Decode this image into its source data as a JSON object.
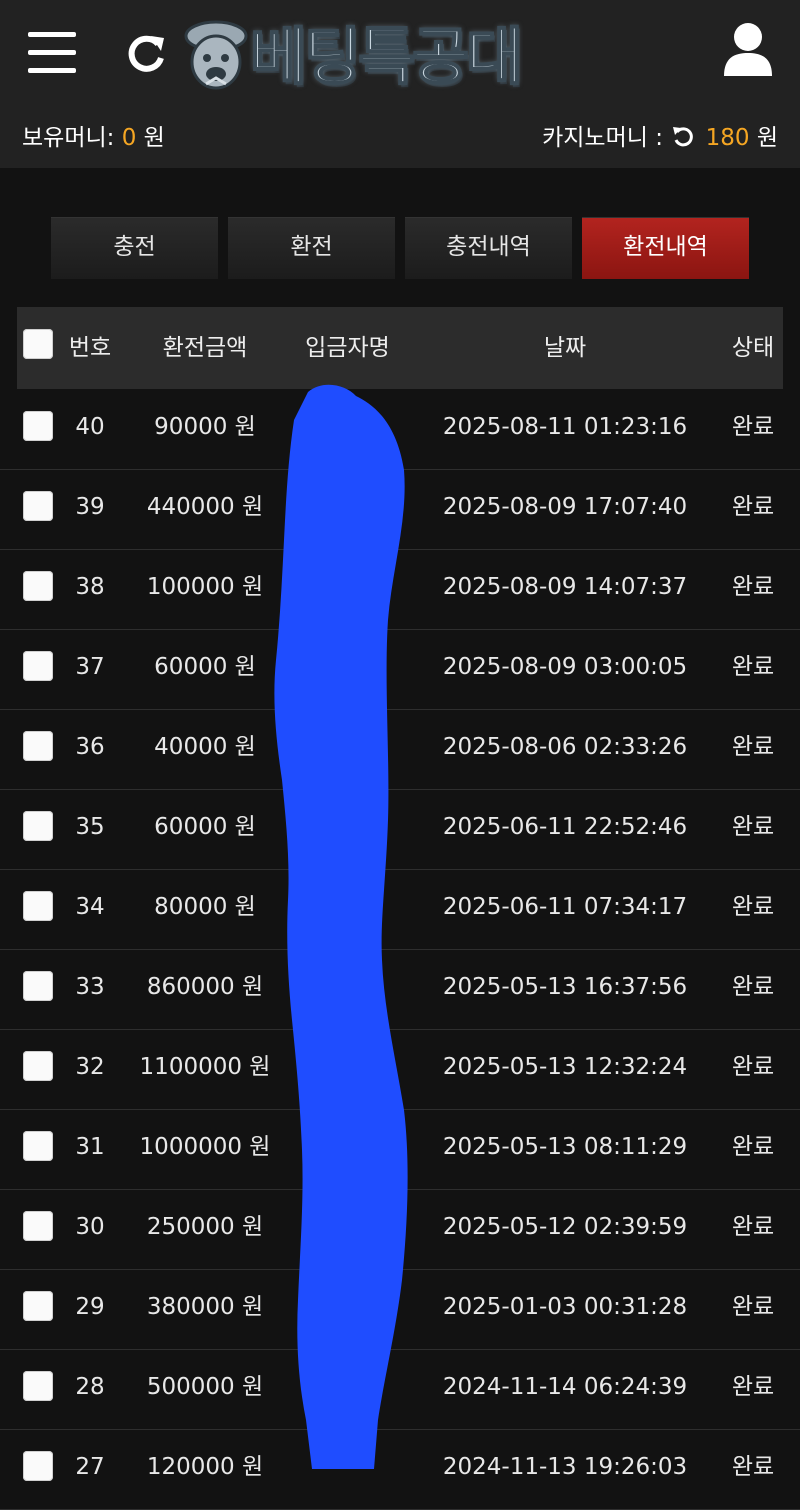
{
  "header": {
    "logo_text": "베팅특공대",
    "balance_label": "보유머니:",
    "balance_value": "0",
    "currency": "원",
    "casino_label": "카지노머니 :",
    "casino_value": "180",
    "casino_currency": "원"
  },
  "tabs": [
    {
      "label": "충전",
      "active": false
    },
    {
      "label": "환전",
      "active": false
    },
    {
      "label": "충전내역",
      "active": false
    },
    {
      "label": "환전내역",
      "active": true
    }
  ],
  "table": {
    "columns": [
      "번호",
      "환전금액",
      "입금자명",
      "날짜",
      "상태"
    ],
    "rows": [
      {
        "no": "40",
        "amount": "90000 원",
        "depositor": "",
        "date": "2025-08-11 01:23:16",
        "status": "완료"
      },
      {
        "no": "39",
        "amount": "440000 원",
        "depositor": "",
        "date": "2025-08-09 17:07:40",
        "status": "완료"
      },
      {
        "no": "38",
        "amount": "100000 원",
        "depositor": "",
        "date": "2025-08-09 14:07:37",
        "status": "완료"
      },
      {
        "no": "37",
        "amount": "60000 원",
        "depositor": "",
        "date": "2025-08-09 03:00:05",
        "status": "완료"
      },
      {
        "no": "36",
        "amount": "40000 원",
        "depositor": "",
        "date": "2025-08-06 02:33:26",
        "status": "완료"
      },
      {
        "no": "35",
        "amount": "60000 원",
        "depositor": "",
        "date": "2025-06-11 22:52:46",
        "status": "완료"
      },
      {
        "no": "34",
        "amount": "80000 원",
        "depositor": "",
        "date": "2025-06-11 07:34:17",
        "status": "완료"
      },
      {
        "no": "33",
        "amount": "860000 원",
        "depositor": "",
        "date": "2025-05-13 16:37:56",
        "status": "완료"
      },
      {
        "no": "32",
        "amount": "1100000 원",
        "depositor": "",
        "date": "2025-05-13 12:32:24",
        "status": "완료"
      },
      {
        "no": "31",
        "amount": "1000000 원",
        "depositor": "",
        "date": "2025-05-13 08:11:29",
        "status": "완료"
      },
      {
        "no": "30",
        "amount": "250000 원",
        "depositor": "",
        "date": "2025-05-12 02:39:59",
        "status": "완료"
      },
      {
        "no": "29",
        "amount": "380000 원",
        "depositor": "",
        "date": "2025-01-03 00:31:28",
        "status": "완료"
      },
      {
        "no": "28",
        "amount": "500000 원",
        "depositor": "",
        "date": "2024-11-14 06:24:39",
        "status": "완료"
      },
      {
        "no": "27",
        "amount": "120000 원",
        "depositor": "",
        "date": "2024-11-13 19:26:03",
        "status": "완료"
      }
    ]
  },
  "icons": {
    "menu": "hamburger-menu-icon",
    "refresh": "refresh-icon",
    "user": "user-icon",
    "casino_refresh": "refresh-ccw-icon"
  },
  "colors": {
    "accent_amount": "#f5a623",
    "active_tab": "#a81e1a",
    "redaction": "#1f4dff",
    "background": "#121212",
    "header_bg": "#222222"
  }
}
